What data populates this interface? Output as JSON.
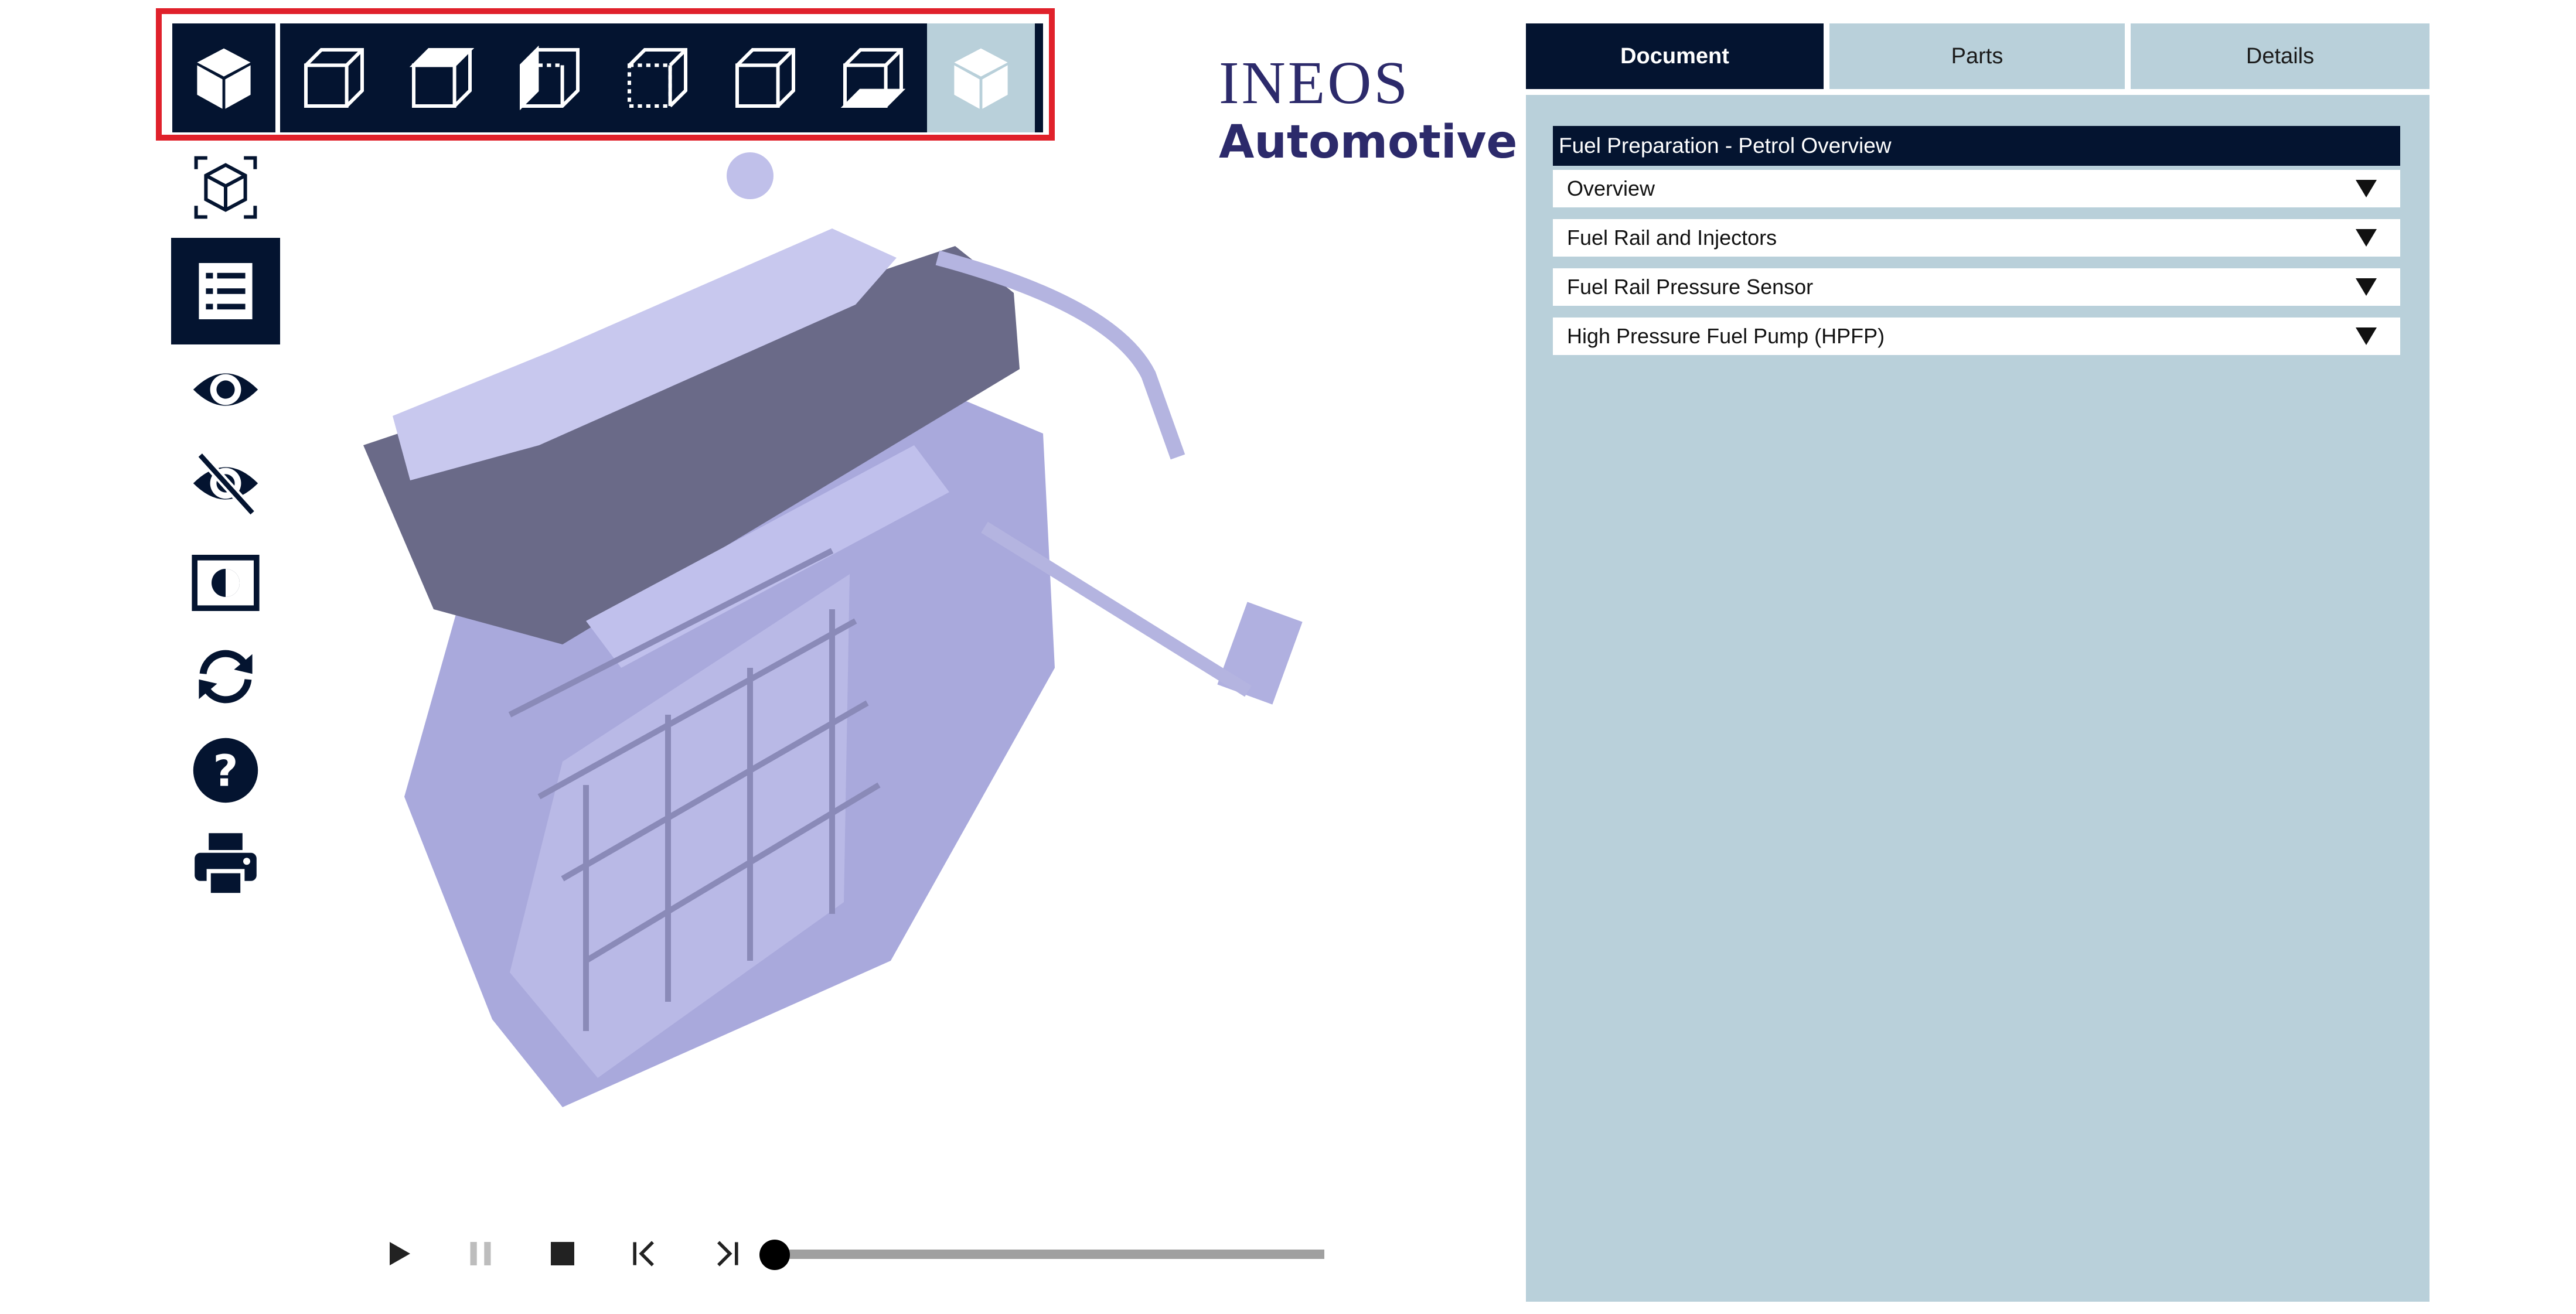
{
  "logo": {
    "line1": "INEOS",
    "line2": "Automotive"
  },
  "tabs": [
    {
      "label": "Document",
      "active": true
    },
    {
      "label": "Parts",
      "active": false
    },
    {
      "label": "Details",
      "active": false
    }
  ],
  "document": {
    "title": "Fuel Preparation - Petrol Overview",
    "items": [
      {
        "label": "Overview"
      },
      {
        "label": "Fuel Rail and Injectors"
      },
      {
        "label": "Fuel Rail Pressure Sensor"
      },
      {
        "label": "High Pressure Fuel Pump (HPFP)"
      }
    ]
  },
  "view_toolbar": {
    "buttons": [
      "iso-view-icon",
      "front-view-icon",
      "top-view-icon",
      "left-view-icon",
      "right-view-icon",
      "back-view-icon",
      "bottom-view-icon",
      "active-view-icon"
    ]
  },
  "side_tools": [
    "fit-view-icon",
    "list-icon",
    "show-icon",
    "hide-icon",
    "contrast-icon",
    "rotate-icon",
    "help-icon",
    "print-icon"
  ],
  "playback": {
    "progress": 0.0,
    "buttons": [
      "play-icon",
      "pause-icon",
      "stop-icon",
      "step-back-icon",
      "step-forward-icon"
    ]
  },
  "colors": {
    "navy": "#041430",
    "pale_blue": "#b9d0da",
    "highlight_red": "#e0212b",
    "logo": "#2c2a6b",
    "model": "#b9b9e6"
  }
}
